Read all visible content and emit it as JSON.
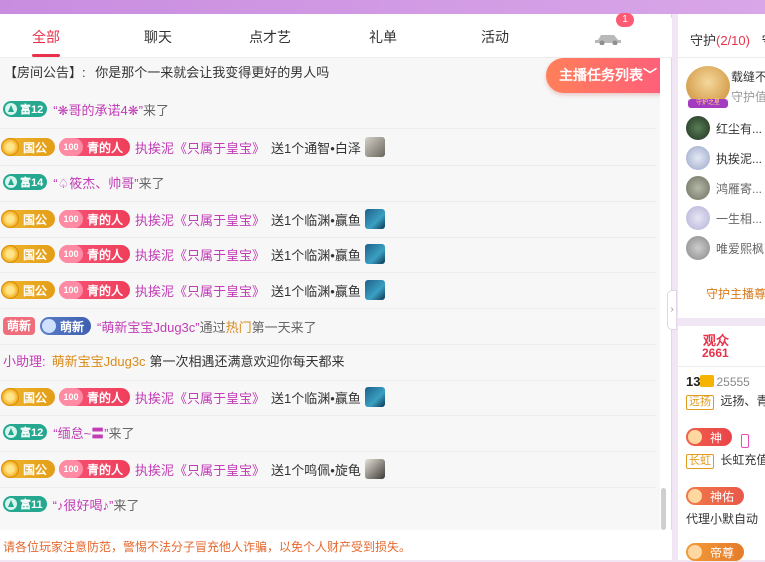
{
  "tabs": [
    "全部",
    "聊天",
    "点才艺",
    "礼单",
    "活动"
  ],
  "tab_badge": "1",
  "announcement": {
    "tag": "【房间公告】:",
    "text": "你是那个一来就会让我变得更好的男人吗"
  },
  "task_button": "主播任务列表",
  "messages": [
    {
      "type": "enter",
      "level": "富12",
      "user": "“❋哥的承诺4❋”",
      "action": "来了"
    },
    {
      "type": "gift",
      "rank": "国公",
      "fan_level": "100",
      "fan": "青的人",
      "user": "执挨泥《只属于皇宝》",
      "action": "送1个通智•白泽"
    },
    {
      "type": "enter",
      "level": "富14",
      "user": "“♤筱杰、帅哥”",
      "action": "来了"
    },
    {
      "type": "gift",
      "rank": "国公",
      "fan_level": "100",
      "fan": "青的人",
      "user": "执挨泥《只属于皇宝》",
      "action": "送1个临渊•赢鱼"
    },
    {
      "type": "gift",
      "rank": "国公",
      "fan_level": "100",
      "fan": "青的人",
      "user": "执挨泥《只属于皇宝》",
      "action": "送1个临渊•赢鱼"
    },
    {
      "type": "gift",
      "rank": "国公",
      "fan_level": "100",
      "fan": "青的人",
      "user": "执挨泥《只属于皇宝》",
      "action": "送1个临渊•赢鱼"
    },
    {
      "type": "new",
      "tag1": "萌新",
      "tag2": "萌新",
      "user": "“萌新宝宝Jdug3c”",
      "via": "通过",
      "hot": "热门",
      "action": "第一天来了"
    },
    {
      "type": "assistant",
      "label": "小助理:",
      "user": "萌新宝宝Jdug3c",
      "text": "第一次相遇还满意欢迎你每天都来"
    },
    {
      "type": "gift",
      "rank": "国公",
      "fan_level": "100",
      "fan": "青的人",
      "user": "执挨泥《只属于皇宝》",
      "action": "送1个临渊•赢鱼"
    },
    {
      "type": "enter",
      "level": "富12",
      "user": "“缅怠~〓”",
      "action": "来了"
    },
    {
      "type": "gift",
      "rank": "国公",
      "fan_level": "100",
      "fan": "青的人",
      "user": "执挨泥《只属于皇宝》",
      "action": "送1个鸣佩•旋龟"
    },
    {
      "type": "enter",
      "level": "富11",
      "user": "“♪很好喝♪”",
      "action": "来了"
    }
  ],
  "warning": "请各位玩家注意防范，警惕不法分子冒充他人诈骗，以免个人财产受到损失。",
  "side": {
    "guard_title": "守护",
    "guard_count": "(2/10)",
    "guard_title_more": "守",
    "guard_main_name": "载缝不",
    "guard_main_sub": "守护值",
    "guard_banner": "守护之星",
    "guards": [
      "红尘有...",
      "执挨泥...",
      "鸿雁寄...",
      "一生相...",
      "唯爱熙枫"
    ],
    "guard_link": "守护主播尊",
    "audience_label": "观众",
    "audience_count": "2661",
    "aud1_level": "13",
    "aud1_id": "25555",
    "aud1_tag": "远扬",
    "aud1_name": "远扬、青",
    "aud2_badge": "神",
    "aud2_tag": "长虹",
    "aud2_name": "长虹充值",
    "aud3_badge": "神佑",
    "aud3_name": "代理小默自动",
    "aud4_badge": "帝尊"
  }
}
